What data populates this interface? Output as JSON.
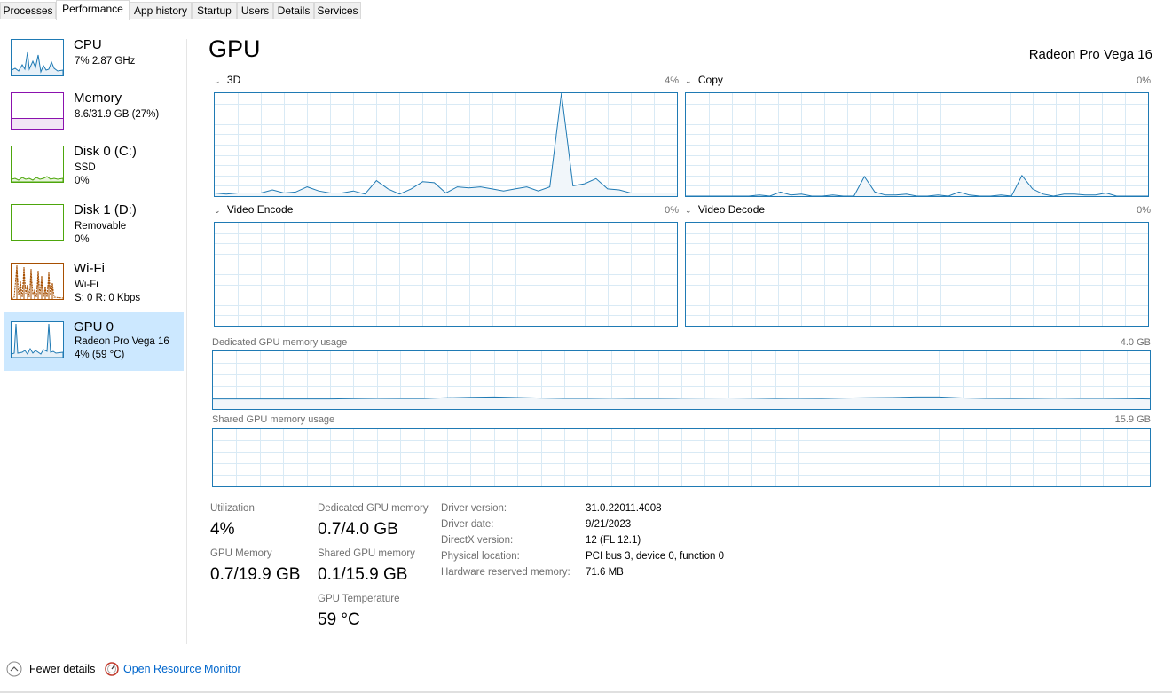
{
  "tabs": [
    "Processes",
    "Performance",
    "App history",
    "Startup",
    "Users",
    "Details",
    "Services"
  ],
  "active_tab": "Performance",
  "sidebar": {
    "items": [
      {
        "title": "CPU",
        "line1": "7% 2.87 GHz",
        "line2": "",
        "color": "#1f7ab4"
      },
      {
        "title": "Memory",
        "line1": "8.6/31.9 GB (27%)",
        "line2": "",
        "color": "#8b12ae"
      },
      {
        "title": "Disk 0 (C:)",
        "line1": "SSD",
        "line2": "0%",
        "color": "#4da60c"
      },
      {
        "title": "Disk 1 (D:)",
        "line1": "Removable",
        "line2": "0%",
        "color": "#4da60c"
      },
      {
        "title": "Wi-Fi",
        "line1": "Wi-Fi",
        "line2": "S: 0 R: 0 Kbps",
        "color": "#a74f01"
      },
      {
        "title": "GPU 0",
        "line1": "Radeon Pro Vega 16",
        "line2": "4% (59 °C)",
        "color": "#1f7ab4",
        "selected": true
      }
    ]
  },
  "main": {
    "title": "GPU",
    "device_name": "Radeon Pro Vega 16",
    "engines": [
      {
        "name": "3D",
        "value": "4%"
      },
      {
        "name": "Copy",
        "value": "0%"
      },
      {
        "name": "Video Encode",
        "value": "0%"
      },
      {
        "name": "Video Decode",
        "value": "0%"
      }
    ],
    "dedicated_graph": {
      "label": "Dedicated GPU memory usage",
      "max": "4.0 GB"
    },
    "shared_graph": {
      "label": "Shared GPU memory usage",
      "max": "15.9 GB"
    },
    "stats": {
      "utilization_label": "Utilization",
      "utilization": "4%",
      "dedicated_label": "Dedicated GPU memory",
      "dedicated": "0.7/4.0 GB",
      "gpu_memory_label": "GPU Memory",
      "gpu_memory": "0.7/19.9 GB",
      "shared_label": "Shared GPU memory",
      "shared": "0.1/15.9 GB",
      "temp_label": "GPU Temperature",
      "temp": "59 °C"
    },
    "info": [
      {
        "label": "Driver version:",
        "value": "31.0.22011.4008"
      },
      {
        "label": "Driver date:",
        "value": "9/21/2023"
      },
      {
        "label": "DirectX version:",
        "value": "12 (FL 12.1)"
      },
      {
        "label": "Physical location:",
        "value": "PCI bus 3, device 0, function 0"
      },
      {
        "label": "Hardware reserved memory:",
        "value": "71.6 MB"
      }
    ]
  },
  "footer": {
    "fewer_details": "Fewer details",
    "open_monitor": "Open Resource Monitor"
  },
  "colors": {
    "gpu_line": "#1f7ab4",
    "gpu_fill": "#f1f6fa",
    "grid": "#d9eaf5",
    "link": "#0066cc",
    "selected_bg": "#cce8ff"
  },
  "series": {
    "3d": [
      3,
      2,
      3,
      3,
      3,
      6,
      3,
      4,
      9,
      5,
      3,
      3,
      5,
      2,
      15,
      7,
      2,
      7,
      14,
      13,
      3,
      9,
      8,
      9,
      7,
      5,
      7,
      9,
      5,
      9,
      100,
      10,
      12,
      17,
      7,
      6,
      3,
      3,
      3,
      3,
      3
    ],
    "copy": [
      0,
      0,
      0,
      0,
      0,
      0,
      0,
      1,
      0,
      4,
      1,
      2,
      0,
      0,
      1,
      0,
      0,
      19,
      4,
      1,
      1,
      2,
      0,
      0,
      1,
      0,
      4,
      1,
      0,
      0,
      1,
      0,
      20,
      7,
      2,
      0,
      2,
      2,
      1,
      1,
      3,
      0,
      0,
      0,
      0
    ],
    "dedicated": [
      0.7,
      0.7,
      0.7,
      0.7,
      0.7,
      0.7,
      0.72,
      0.74,
      0.73,
      0.73,
      0.78,
      0.82,
      0.84,
      0.8,
      0.76,
      0.74,
      0.74,
      0.75,
      0.74,
      0.74,
      0.75,
      0.76,
      0.77,
      0.75,
      0.73,
      0.74,
      0.73,
      0.76,
      0.78,
      0.8,
      0.84,
      0.84,
      0.77,
      0.74,
      0.73,
      0.74,
      0.75,
      0.74,
      0.74,
      0.72,
      0.7
    ]
  }
}
